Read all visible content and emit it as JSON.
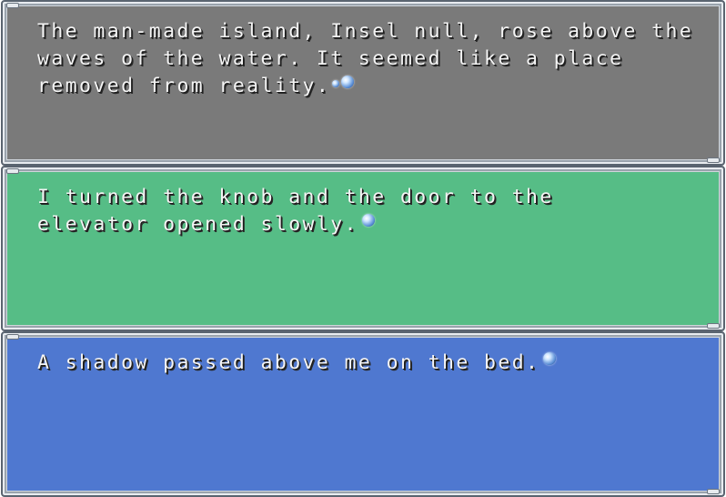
{
  "messages": [
    {
      "id": "box-1",
      "background": "#7a7a7a",
      "lines": [
        "The man-made island, Insel null, rose above the",
        "waves of the water. It seemed like a place",
        "removed from reality."
      ],
      "continue_icon": "bubble-continue-icon"
    },
    {
      "id": "box-2",
      "background": "#56bd86",
      "lines": [
        "I turned the knob and the door to the",
        "elevator opened slowly."
      ],
      "continue_icon": "bubble-continue-icon"
    },
    {
      "id": "box-3",
      "background": "#4f78d0",
      "lines": [
        "A shadow passed above me on the bed."
      ],
      "continue_icon": "bubble-continue-icon"
    }
  ]
}
